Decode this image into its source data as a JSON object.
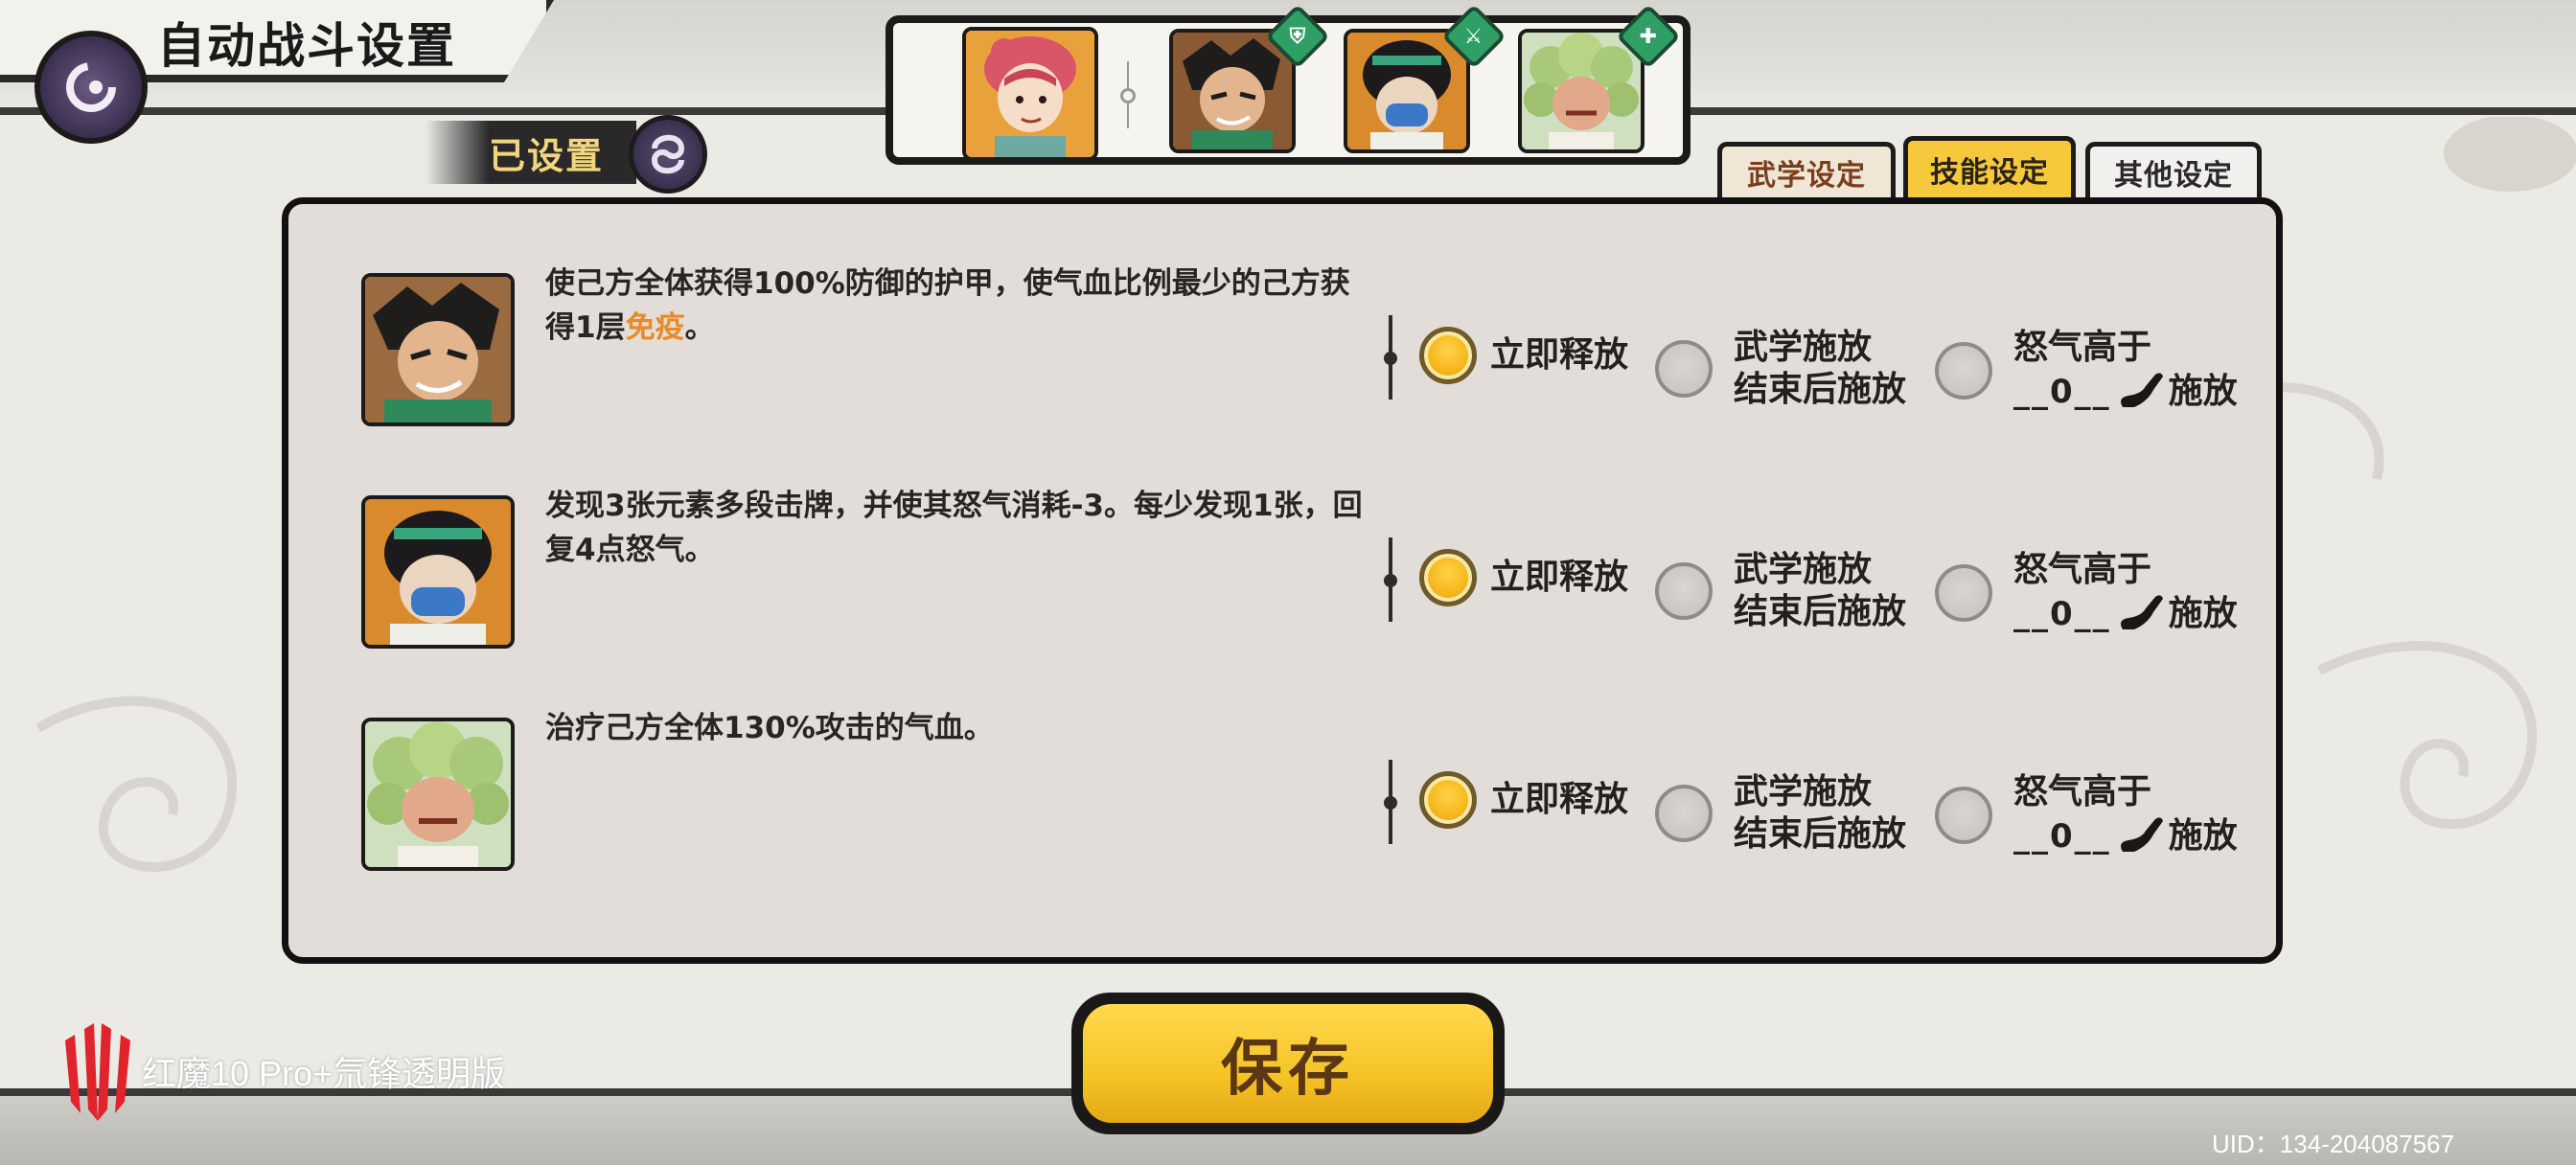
{
  "header": {
    "title": "自动战斗设置",
    "configured_label": "已设置"
  },
  "team": {
    "leader": "leader-portrait",
    "members": [
      {
        "portrait": "hero-green-robe",
        "badge_icon": "shield-icon"
      },
      {
        "portrait": "hero-masked",
        "badge_icon": "sword-icon"
      },
      {
        "portrait": "hero-cloud-hair",
        "badge_icon": "heal-icon"
      }
    ]
  },
  "tabs": [
    {
      "label": "武学设定",
      "active": false
    },
    {
      "label": "技能设定",
      "active": true
    },
    {
      "label": "其他设定",
      "active": false
    }
  ],
  "skills": [
    {
      "desc_before": "使己方全体获得100%防御的护甲，使气血比例最少的己方获得1层",
      "desc_highlight": "免疫",
      "desc_after": "。",
      "selected": "now",
      "rage_value": "__0__"
    },
    {
      "desc_before": "发现3张元素多段击牌，并使其怒气消耗-3。每少发现1张，回复4点怒气。",
      "desc_highlight": "",
      "desc_after": "",
      "selected": "now",
      "rage_value": "__0__"
    },
    {
      "desc_before": "治疗己方全体130%攻击的气血。",
      "desc_highlight": "",
      "desc_after": "",
      "selected": "now",
      "rage_value": "__0__"
    }
  ],
  "options": {
    "now": "立即释放",
    "after_line1": "武学施放",
    "after_line2": "结束后施放",
    "rage_line1": "怒气高于",
    "rage_suffix": "施放"
  },
  "save_label": "保存",
  "watermark": "红魔10 Pro+氘锋透明版",
  "uid": "UID：134-204087567",
  "colors": {
    "accent_gold": "#f5c426",
    "highlight_orange": "#e98a28",
    "badge_green": "#2f9f66",
    "panel_bg": "#e2ddd8"
  }
}
